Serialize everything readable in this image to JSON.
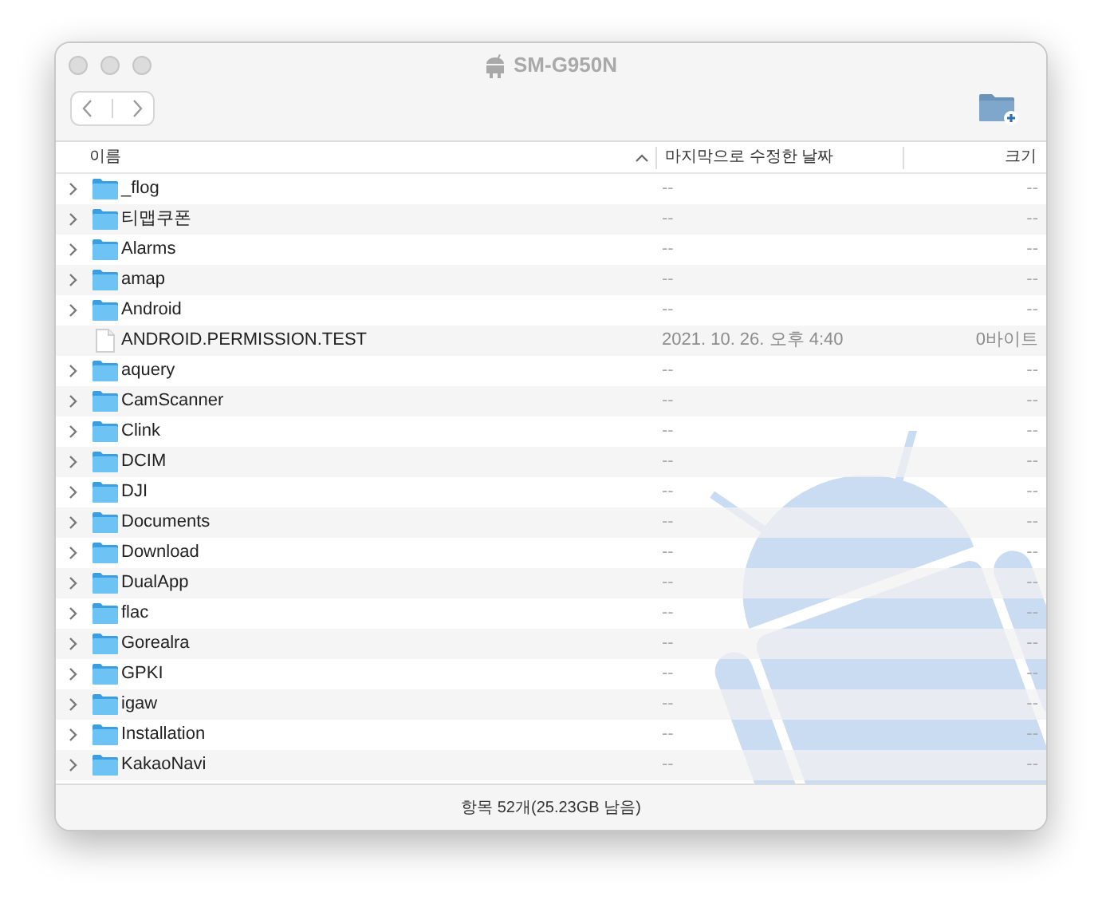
{
  "window": {
    "title": "SM-G950N"
  },
  "columns": [
    "이름",
    "마지막으로 수정한 날짜",
    "크기"
  ],
  "rows": [
    {
      "name": "_flog",
      "kind": "folder",
      "modified": "--",
      "size": "--"
    },
    {
      "name": "티맵쿠폰",
      "kind": "folder",
      "modified": "--",
      "size": "--"
    },
    {
      "name": "Alarms",
      "kind": "folder",
      "modified": "--",
      "size": "--"
    },
    {
      "name": "amap",
      "kind": "folder",
      "modified": "--",
      "size": "--"
    },
    {
      "name": "Android",
      "kind": "folder",
      "modified": "--",
      "size": "--"
    },
    {
      "name": "ANDROID.PERMISSION.TEST",
      "kind": "file",
      "modified": "2021. 10. 26. 오후 4:40",
      "size": "0바이트"
    },
    {
      "name": "aquery",
      "kind": "folder",
      "modified": "--",
      "size": "--"
    },
    {
      "name": "CamScanner",
      "kind": "folder",
      "modified": "--",
      "size": "--"
    },
    {
      "name": "Clink",
      "kind": "folder",
      "modified": "--",
      "size": "--"
    },
    {
      "name": "DCIM",
      "kind": "folder",
      "modified": "--",
      "size": "--"
    },
    {
      "name": "DJI",
      "kind": "folder",
      "modified": "--",
      "size": "--"
    },
    {
      "name": "Documents",
      "kind": "folder",
      "modified": "--",
      "size": "--"
    },
    {
      "name": "Download",
      "kind": "folder",
      "modified": "--",
      "size": "--"
    },
    {
      "name": "DualApp",
      "kind": "folder",
      "modified": "--",
      "size": "--"
    },
    {
      "name": "flac",
      "kind": "folder",
      "modified": "--",
      "size": "--"
    },
    {
      "name": "Gorealra",
      "kind": "folder",
      "modified": "--",
      "size": "--"
    },
    {
      "name": "GPKI",
      "kind": "folder",
      "modified": "--",
      "size": "--"
    },
    {
      "name": "igaw",
      "kind": "folder",
      "modified": "--",
      "size": "--"
    },
    {
      "name": "Installation",
      "kind": "folder",
      "modified": "--",
      "size": "--"
    },
    {
      "name": "KakaoNavi",
      "kind": "folder",
      "modified": "--",
      "size": "--"
    }
  ],
  "status_bar": "항목 52개(25.23GB 남음)"
}
